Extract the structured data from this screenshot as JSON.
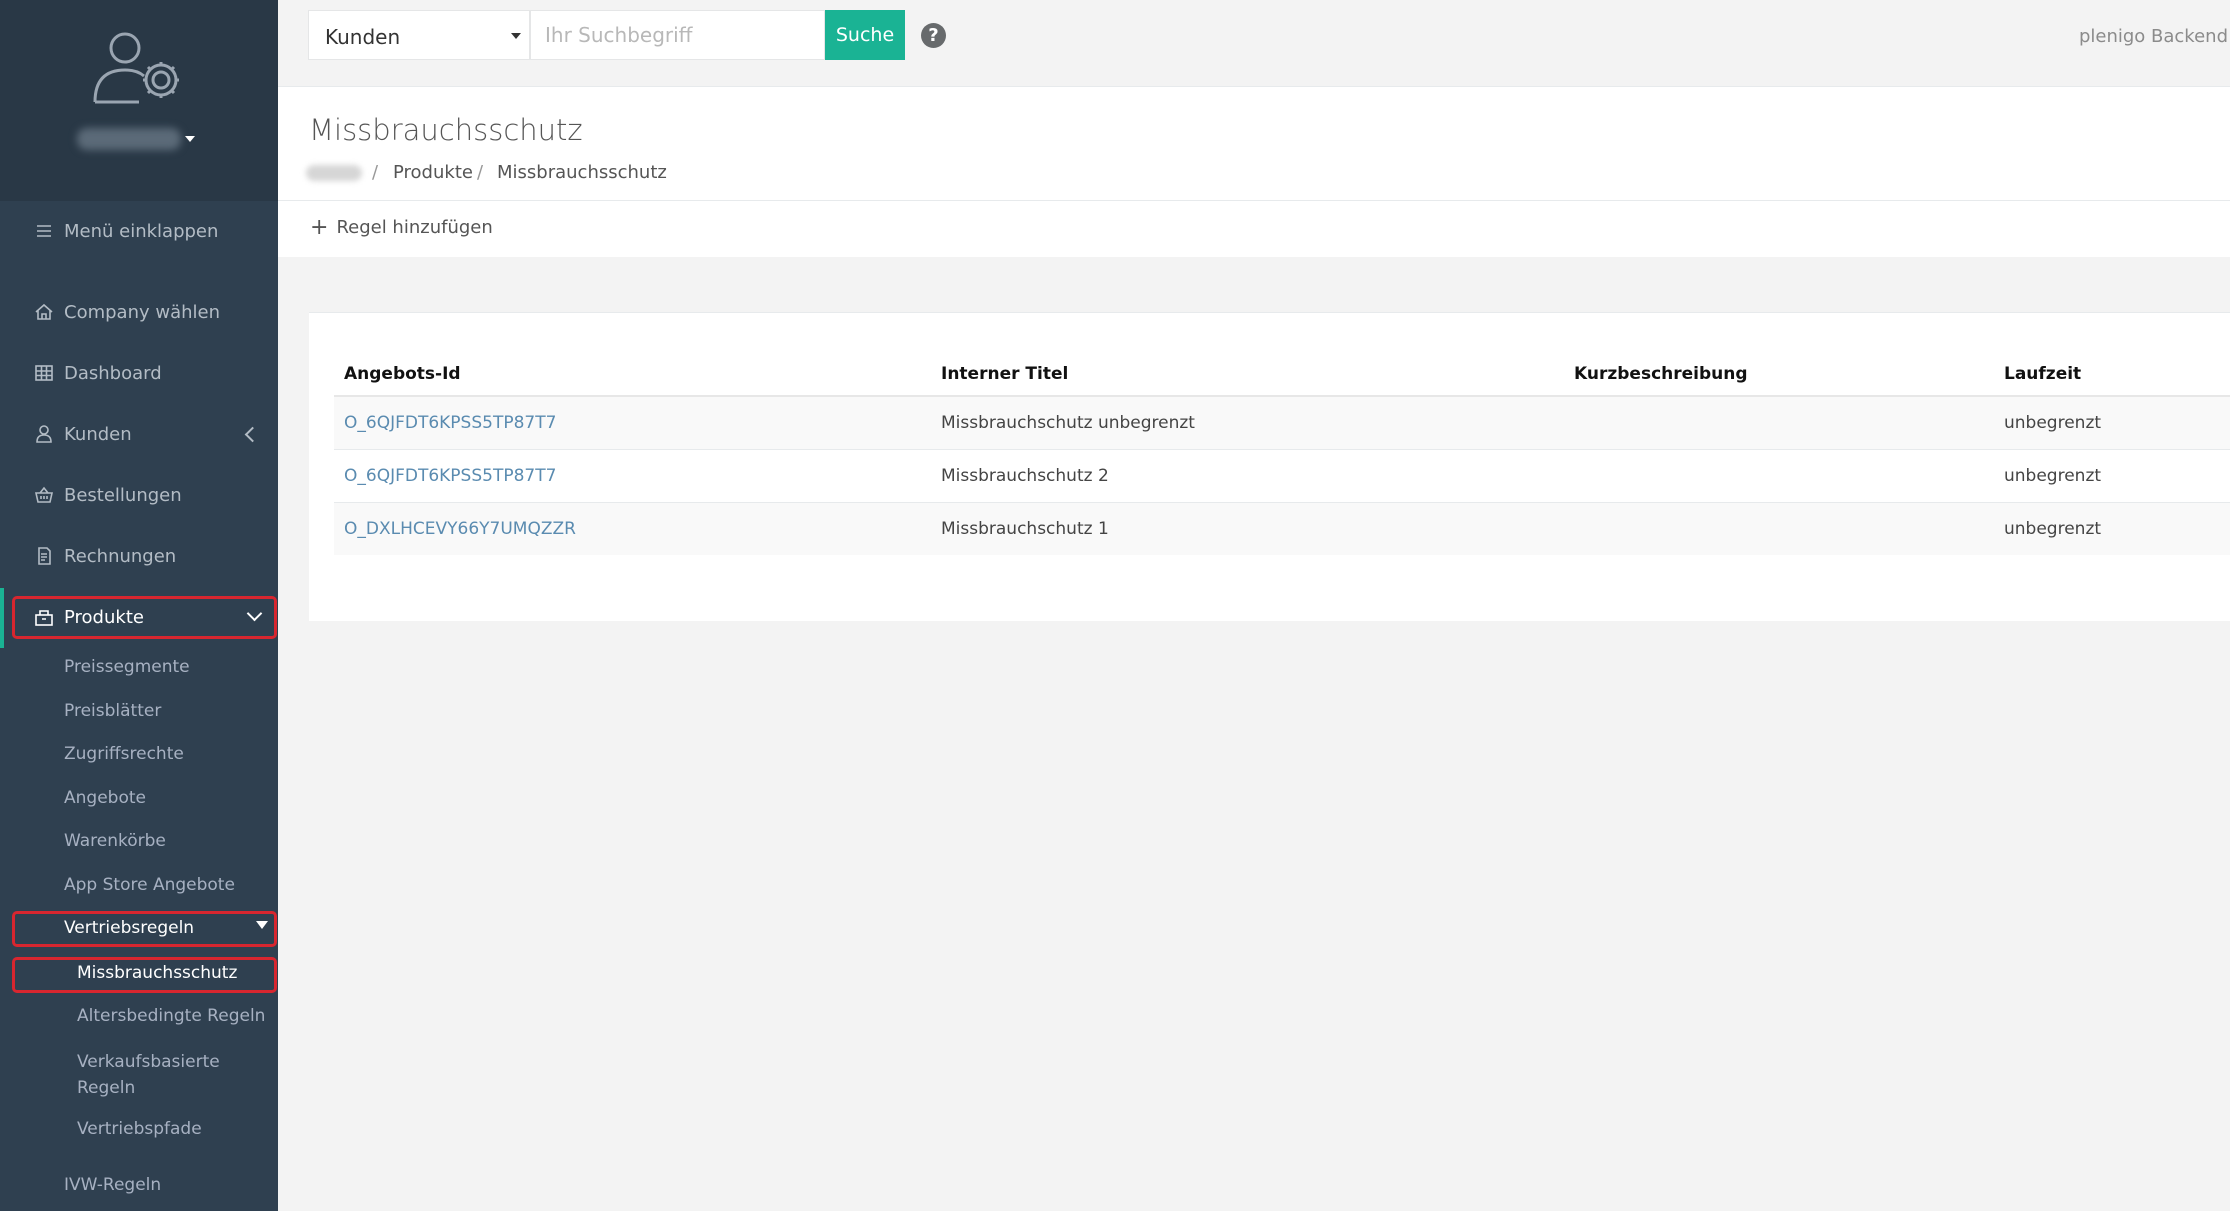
{
  "app": {
    "brand": "plenigo Backend"
  },
  "search": {
    "scope": "Kunden",
    "placeholder": "Ihr Suchbegriff",
    "button": "Suche",
    "help": "?"
  },
  "sidebar": {
    "collapse": "Menü einklappen",
    "items": [
      {
        "label": "Company wählen",
        "icon": "home-icon"
      },
      {
        "label": "Dashboard",
        "icon": "grid-icon"
      },
      {
        "label": "Kunden",
        "icon": "user-icon"
      },
      {
        "label": "Bestellungen",
        "icon": "basket-icon"
      },
      {
        "label": "Rechnungen",
        "icon": "receipt-icon"
      },
      {
        "label": "Produkte",
        "icon": "box-icon"
      }
    ],
    "products_sub": [
      "Preissegmente",
      "Preisblätter",
      "Zugriffsrechte",
      "Angebote",
      "Warenkörbe",
      "App Store Angebote"
    ],
    "sales_rules": "Vertriebsregeln",
    "sales_sub": [
      "Missbrauchsschutz",
      "Altersbedingte Regeln",
      "Verkaufsbasierte Regeln",
      "Vertriebspfade"
    ],
    "ivw": "IVW-Regeln"
  },
  "page": {
    "title": "Missbrauchsschutz",
    "breadcrumb": [
      "Produkte",
      "Missbrauchsschutz"
    ],
    "add_rule": "Regel hinzufügen"
  },
  "table": {
    "headers": [
      "Angebots-Id",
      "Interner Titel",
      "Kurzbeschreibung",
      "Laufzeit"
    ],
    "rows": [
      [
        "O_6QJFDT6KPSS5TP87T7",
        "Missbrauchschutz unbegrenzt",
        "",
        "unbegrenzt"
      ],
      [
        "O_6QJFDT6KPSS5TP87T7",
        "Missbrauchschutz 2",
        "",
        "unbegrenzt"
      ],
      [
        "O_DXLHCEVY66Y7UMQZZR",
        "Missbrauchschutz 1",
        "",
        "unbegrenzt"
      ]
    ]
  },
  "colors": {
    "sidebar": "#2f4050",
    "accent": "#1ab394",
    "highlight": "#d8262f",
    "link": "#5a8bb0"
  }
}
